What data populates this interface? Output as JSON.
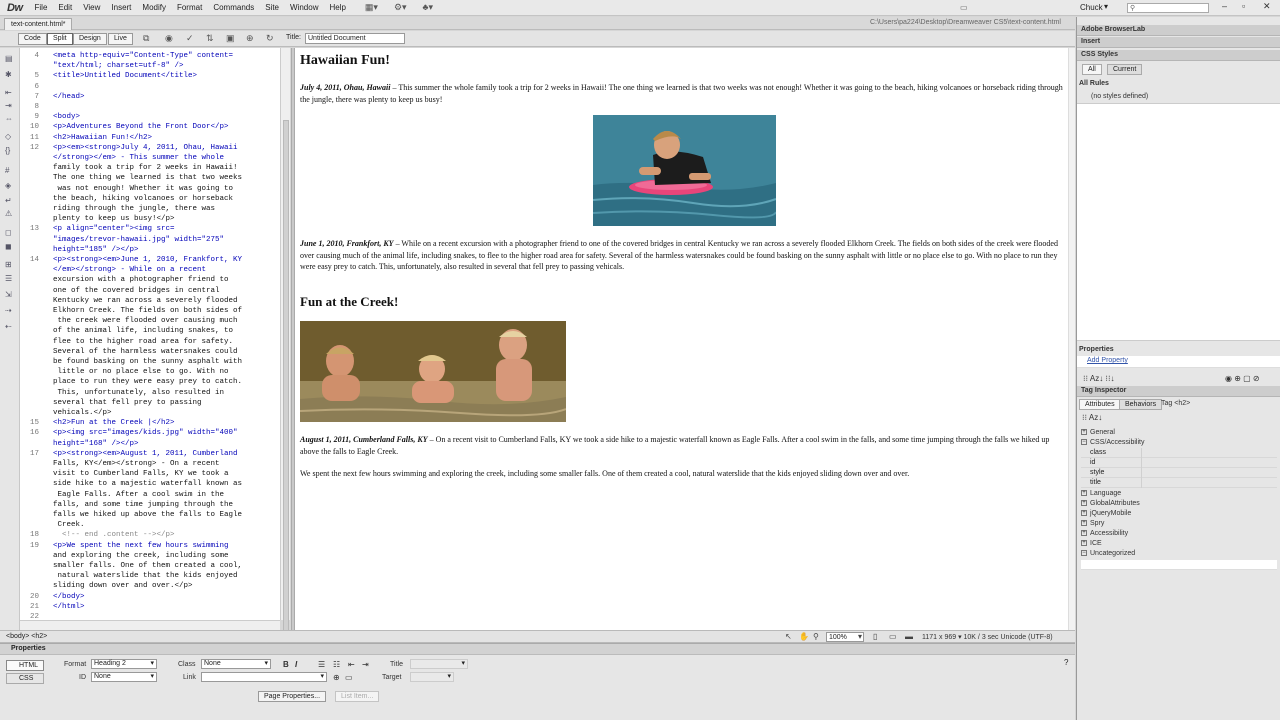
{
  "app": {
    "logo": "Dw",
    "user": "Chuck"
  },
  "menu": [
    "File",
    "Edit",
    "View",
    "Insert",
    "Modify",
    "Format",
    "Commands",
    "Site",
    "Window",
    "Help"
  ],
  "doc": {
    "tab": "text-content.html*",
    "path": "C:\\Users\\pa224\\Desktop\\Dreamweaver CS5\\text-content.html",
    "views": [
      "Code",
      "Split",
      "Design",
      "Live"
    ],
    "title_label": "Title:",
    "title_value": "Untitled Document"
  },
  "code_lines": [
    {
      "n": "4",
      "t": "<meta http-equiv=\"Content-Type\" content="
    },
    {
      "n": "",
      "t": "\"text/html; charset=utf-8\" />"
    },
    {
      "n": "5",
      "t": "<title>Untitled Document</title>"
    },
    {
      "n": "6",
      "t": ""
    },
    {
      "n": "7",
      "t": "</head>"
    },
    {
      "n": "8",
      "t": ""
    },
    {
      "n": "9",
      "t": "<body>"
    },
    {
      "n": "10",
      "t": "<p>Adventures Beyond the Front Door</p>"
    },
    {
      "n": "11",
      "t": "<h2>Hawaiian Fun!</h2>"
    },
    {
      "n": "12",
      "t": "<p><em><strong>July 4, 2011, Ohau, Hawaii"
    },
    {
      "n": "",
      "t": "</strong></em> - This summer the whole"
    },
    {
      "n": "",
      "t": "family took a trip for 2 weeks in Hawaii!"
    },
    {
      "n": "",
      "t": "The one thing we learned is that two weeks"
    },
    {
      "n": "",
      "t": " was not enough! Whether it was going to"
    },
    {
      "n": "",
      "t": "the beach, hiking volcanoes or horseback"
    },
    {
      "n": "",
      "t": "riding through the jungle, there was"
    },
    {
      "n": "",
      "t": "plenty to keep us busy!</p>"
    },
    {
      "n": "13",
      "t": "<p align=\"center\"><img src="
    },
    {
      "n": "",
      "t": "\"images/trevor-hawaii.jpg\" width=\"275\""
    },
    {
      "n": "",
      "t": "height=\"185\" /></p>"
    },
    {
      "n": "14",
      "t": "<p><strong><em>June 1, 2010, Frankfort, KY"
    },
    {
      "n": "",
      "t": "</em></strong> - While on a recent"
    },
    {
      "n": "",
      "t": "excursion with a photographer friend to"
    },
    {
      "n": "",
      "t": "one of the covered bridges in central"
    },
    {
      "n": "",
      "t": "Kentucky we ran across a severely flooded"
    },
    {
      "n": "",
      "t": "Elkhorn Creek. The fields on both sides of"
    },
    {
      "n": "",
      "t": " the creek were flooded over causing much"
    },
    {
      "n": "",
      "t": "of the animal life, including snakes, to"
    },
    {
      "n": "",
      "t": "flee to the higher road area for safety."
    },
    {
      "n": "",
      "t": "Several of the harmless watersnakes could"
    },
    {
      "n": "",
      "t": "be found basking on the sunny asphalt with"
    },
    {
      "n": "",
      "t": " little or no place else to go. With no"
    },
    {
      "n": "",
      "t": "place to run they were easy prey to catch."
    },
    {
      "n": "",
      "t": " This, unfortunately, also resulted in"
    },
    {
      "n": "",
      "t": "several that fell prey to passing"
    },
    {
      "n": "",
      "t": "vehicals.</p>"
    },
    {
      "n": "15",
      "t": "<h2>Fun at the Creek |</h2>"
    },
    {
      "n": "16",
      "t": "<p><img src=\"images/kids.jpg\" width=\"400\""
    },
    {
      "n": "",
      "t": "height=\"168\" /></p>"
    },
    {
      "n": "17",
      "t": "<p><strong><em>August 1, 2011, Cumberland"
    },
    {
      "n": "",
      "t": "Falls, KY</em></strong> - On a recent"
    },
    {
      "n": "",
      "t": "visit to Cumberland Falls, KY we took a"
    },
    {
      "n": "",
      "t": "side hike to a majestic waterfall known as"
    },
    {
      "n": "",
      "t": " Eagle Falls. After a cool swim in the"
    },
    {
      "n": "",
      "t": "falls, and some time jumping through the"
    },
    {
      "n": "",
      "t": "falls we hiked up above the falls to Eagle"
    },
    {
      "n": "",
      "t": " Creek."
    },
    {
      "n": "18",
      "t": "  <!-- end .content --></p>"
    },
    {
      "n": "19",
      "t": "<p>We spent the next few hours swimming"
    },
    {
      "n": "",
      "t": "and exploring the creek, including some"
    },
    {
      "n": "",
      "t": "smaller falls. One of them created a cool,"
    },
    {
      "n": "",
      "t": " natural waterslide that the kids enjoyed"
    },
    {
      "n": "",
      "t": "sliding down over and over.</p>"
    },
    {
      "n": "20",
      "t": "</body>"
    },
    {
      "n": "21",
      "t": "</html>"
    },
    {
      "n": "22",
      "t": ""
    }
  ],
  "design": {
    "h2_1": "Hawaiian Fun!",
    "p1_date": "July 4, 2011, Ohau, Hawaii",
    "p1_text": " – This summer the whole family took a trip for 2 weeks in Hawaii! The one thing we learned is that two weeks was not enough! Whether it was going to the beach, hiking volcanoes or horseback riding through the jungle, there was plenty to keep us busy!",
    "p2_date": "June 1, 2010, Frankfort, KY",
    "p2_text": " – While on a recent excursion with a photographer friend to one of the covered bridges in central Kentucky we ran across a severely flooded Elkhorn Creek. The fields on both sides of the creek were flooded over causing much of the animal life, including snakes, to flee to the higher road area for safety. Several of the harmless watersnakes could be found basking on the sunny asphalt with little or no place else to go. With no place to run they were easy prey to catch. This, unfortunately, also resulted in several that fell prey to passing vehicals.",
    "h2_2": "Fun at the Creek!",
    "p3_date": "August 1, 2011, Cumberland Falls, KY",
    "p3_text": " – On a recent visit to Cumberland Falls, KY we took a side hike to a majestic waterfall known as Eagle Falls. After a cool swim in the falls, and some time jumping through the falls we hiked up above the falls to Eagle Creek.",
    "p4_text": "We spent the next few hours swimming and exploring the creek, including some smaller falls. One of them created a cool, natural waterslide that the kids enjoyed sliding down over and over."
  },
  "status": {
    "tag_path": "<body> <h2>",
    "zoom": "100%",
    "dims": "1171 x 969 ▾   10K / 3 sec   Unicode (UTF-8)"
  },
  "props": {
    "header": "Properties",
    "html_btn": "HTML",
    "css_btn": "CSS",
    "format_label": "Format",
    "format_value": "Heading 2",
    "class_label": "Class",
    "class_value": "None",
    "id_label": "ID",
    "id_value": "None",
    "link_label": "Link",
    "title_label": "Title",
    "target_label": "Target",
    "page_props_btn": "Page Properties...",
    "list_item_btn": "List Item..."
  },
  "right": {
    "browserlab": "Adobe BrowserLab",
    "insert": "Insert",
    "css_styles": "CSS Styles",
    "tab_all": "All",
    "tab_current": "Current",
    "all_rules": "All Rules",
    "no_styles": "(no styles defined)",
    "properties": "Properties",
    "add_property": "Add Property",
    "tag_inspector": "Tag Inspector",
    "tab_attributes": "Attributes",
    "tab_behaviors": "Behaviors",
    "tag_label": "Tag <h2>",
    "categories": [
      "General",
      "CSS/Accessibility",
      "Language",
      "GlobalAttributes",
      "jQueryMobile",
      "Spry",
      "Accessibility",
      "ICE",
      "Uncategorized"
    ],
    "css_attrs": [
      "class",
      "id",
      "style",
      "title"
    ]
  }
}
